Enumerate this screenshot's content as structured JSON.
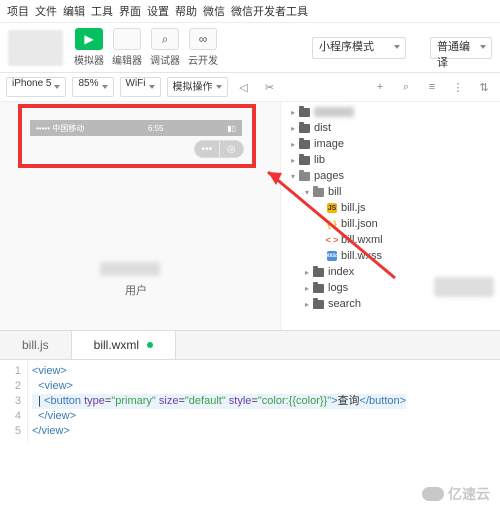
{
  "menu": [
    "项目",
    "文件",
    "编辑",
    "工具",
    "界面",
    "设置",
    "帮助",
    "微信",
    "微信开发者工具"
  ],
  "toolbar": {
    "buttons": [
      {
        "icon": "▶",
        "label": "模拟器",
        "primary": true
      },
      {
        "icon": "</>",
        "label": "编辑器",
        "primary": false
      },
      {
        "icon": "⌕",
        "label": "调试器",
        "primary": false
      },
      {
        "icon": "∞",
        "label": "云开发",
        "primary": false
      }
    ],
    "mode": "小程序模式",
    "compile": "普通编译"
  },
  "secbar": {
    "device": "iPhone 5",
    "zoom": "85%",
    "net": "WiFi",
    "sim": "模拟操作",
    "icons_right": [
      "+",
      "⌕",
      "≡",
      "⋮",
      "⇅"
    ]
  },
  "simulator": {
    "left": "•••••  中国移动",
    "time": "6:55",
    "userlabel": "用户"
  },
  "tree": {
    "items": [
      {
        "d": 0,
        "t": "folder",
        "open": false,
        "name": "",
        "blur": true
      },
      {
        "d": 0,
        "t": "folder",
        "open": false,
        "name": "dist"
      },
      {
        "d": 0,
        "t": "folder",
        "open": false,
        "name": "image"
      },
      {
        "d": 0,
        "t": "folder",
        "open": false,
        "name": "lib"
      },
      {
        "d": 0,
        "t": "folder",
        "open": true,
        "name": "pages"
      },
      {
        "d": 1,
        "t": "folder",
        "open": true,
        "name": "bill"
      },
      {
        "d": 2,
        "t": "file",
        "ext": "js",
        "name": "bill.js"
      },
      {
        "d": 2,
        "t": "file",
        "ext": "json",
        "name": "bill.json"
      },
      {
        "d": 2,
        "t": "file",
        "ext": "wxml",
        "name": "bill.wxml"
      },
      {
        "d": 2,
        "t": "file",
        "ext": "wxss",
        "name": "bill.wxss"
      },
      {
        "d": 1,
        "t": "folder",
        "open": false,
        "name": "index"
      },
      {
        "d": 1,
        "t": "folder",
        "open": false,
        "name": "logs"
      },
      {
        "d": 1,
        "t": "folder",
        "open": false,
        "name": "search"
      }
    ]
  },
  "tabs": [
    {
      "name": "bill.js",
      "active": false
    },
    {
      "name": "bill.wxml",
      "active": true,
      "dirty": true
    }
  ],
  "code": {
    "lines": [
      {
        "n": 1,
        "html": "<span class='tag'>&lt;view&gt;</span>"
      },
      {
        "n": 2,
        "html": "  <span class='tag'>&lt;view&gt;</span>"
      },
      {
        "n": 3,
        "html": "  | <span class='tag'>&lt;button</span> <span class='attrk'>type</span>=<span class='str'>\"primary\"</span> <span class='attrk'>size</span>=<span class='str'>\"default\"</span> <span class='attrk'>style</span>=<span class='str'>\"color:{{color}}\"</span><span class='tag'>&gt;</span><span class='txt'>查询</span><span class='tag'>&lt;/button&gt;</span>",
        "hl": true
      },
      {
        "n": 4,
        "html": "  <span class='tag'>&lt;/view&gt;</span>"
      },
      {
        "n": 5,
        "html": "<span class='tag'>&lt;/view&gt;</span>"
      }
    ]
  },
  "watermark": "亿速云"
}
